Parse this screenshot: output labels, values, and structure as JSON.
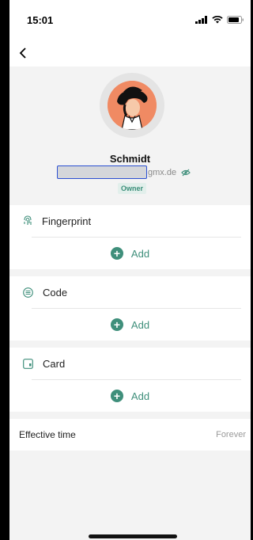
{
  "status": {
    "time": "15:01"
  },
  "profile": {
    "name": "Schmidt",
    "email_suffix": "gmx.de",
    "role": "Owner"
  },
  "sections": [
    {
      "label": "Fingerprint",
      "icon": "fingerprint-icon",
      "add_label": "Add"
    },
    {
      "label": "Code",
      "icon": "keypad-icon",
      "add_label": "Add"
    },
    {
      "label": "Card",
      "icon": "card-icon",
      "add_label": "Add"
    }
  ],
  "effective_time": {
    "label": "Effective time",
    "value": "Forever"
  },
  "colors": {
    "accent": "#3f8f7b",
    "background": "#f3f3f3"
  }
}
